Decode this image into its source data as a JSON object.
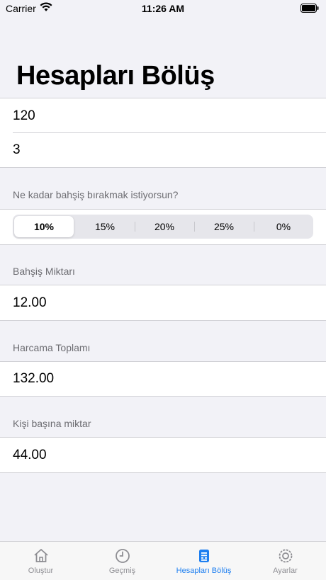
{
  "status": {
    "carrier": "Carrier",
    "time": "11:26 AM"
  },
  "title": "Hesapları Bölüş",
  "inputs": {
    "amount": "120",
    "people": "3"
  },
  "tip_question": "Ne kadar bahşiş bırakmak istiyorsun?",
  "tip_options": [
    "10%",
    "15%",
    "20%",
    "25%",
    "0%"
  ],
  "tip_selected": "10%",
  "results": {
    "tip_label": "Bahşiş Miktarı",
    "tip_value": "12.00",
    "total_label": "Harcama Toplamı",
    "total_value": "132.00",
    "per_person_label": "Kişi başına miktar",
    "per_person_value": "44.00"
  },
  "tabs": {
    "create": "Oluştur",
    "history": "Geçmiş",
    "split": "Hesapları Bölüş",
    "settings": "Ayarlar",
    "active": "split"
  },
  "colors": {
    "accent": "#1e7ff0",
    "background": "#f2f2f7",
    "secondary_text": "#6d6d72"
  }
}
